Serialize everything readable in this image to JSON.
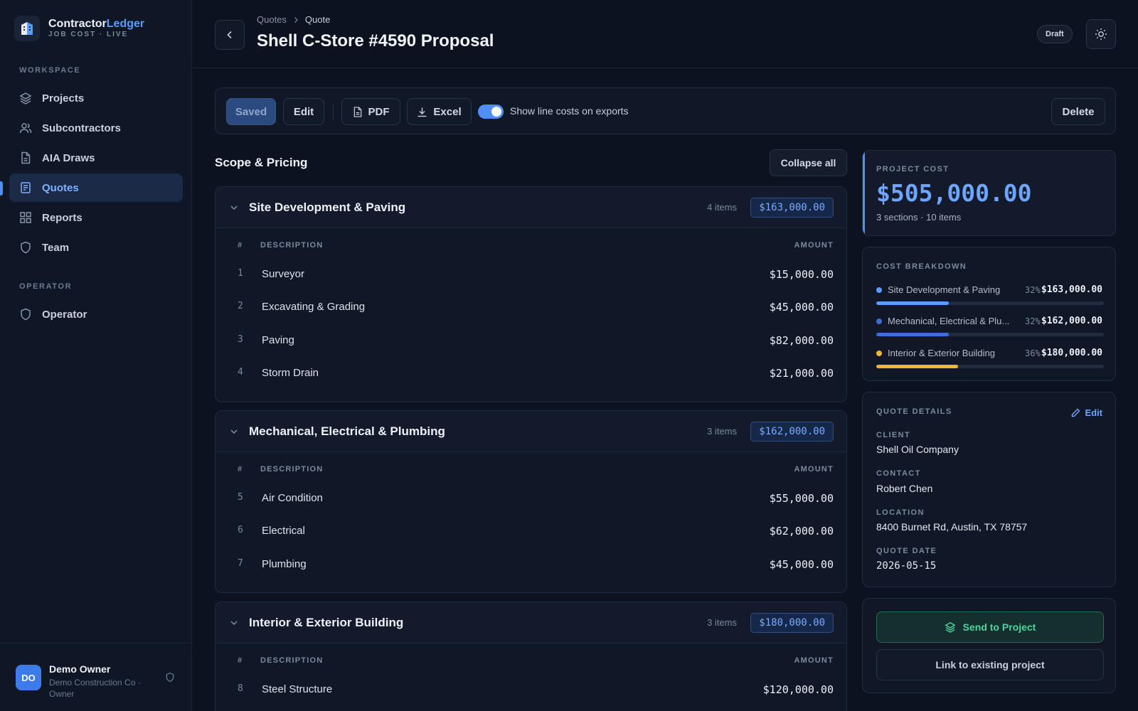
{
  "brand": {
    "name_main": "Contractor",
    "name_accent": "Ledger",
    "subtitle": "JOB COST · LIVE"
  },
  "sidebar": {
    "workspace_label": "WORKSPACE",
    "items": [
      {
        "label": "Projects",
        "icon": "layers-icon"
      },
      {
        "label": "Subcontractors",
        "icon": "users-icon"
      },
      {
        "label": "AIA Draws",
        "icon": "document-icon"
      },
      {
        "label": "Quotes",
        "icon": "receipt-icon",
        "active": true
      },
      {
        "label": "Reports",
        "icon": "grid-icon"
      },
      {
        "label": "Team",
        "icon": "shield-icon"
      }
    ],
    "operator_label": "OPERATOR",
    "operator_item": {
      "label": "Operator",
      "icon": "shield-icon"
    },
    "user": {
      "initials": "DO",
      "name": "Demo Owner",
      "org": "Demo Construction Co · Owner"
    }
  },
  "header": {
    "breadcrumb": [
      "Quotes",
      "Quote"
    ],
    "title": "Shell C-Store #4590 Proposal",
    "status": "Draft"
  },
  "toolbar": {
    "saved_label": "Saved",
    "edit_label": "Edit",
    "pdf_label": "PDF",
    "excel_label": "Excel",
    "toggle_label": "Show line costs on exports",
    "toggle_on": true,
    "delete_label": "Delete"
  },
  "scope": {
    "title": "Scope & Pricing",
    "collapse_label": "Collapse all",
    "col_num": "#",
    "col_desc": "DESCRIPTION",
    "col_amount": "AMOUNT",
    "sections": [
      {
        "name": "Site Development & Paving",
        "count": "4 items",
        "total": "$163,000.00",
        "rows": [
          {
            "num": "1",
            "desc": "Surveyor",
            "amount": "$15,000.00"
          },
          {
            "num": "2",
            "desc": "Excavating & Grading",
            "amount": "$45,000.00"
          },
          {
            "num": "3",
            "desc": "Paving",
            "amount": "$82,000.00"
          },
          {
            "num": "4",
            "desc": "Storm Drain",
            "amount": "$21,000.00"
          }
        ]
      },
      {
        "name": "Mechanical, Electrical & Plumbing",
        "count": "3 items",
        "total": "$162,000.00",
        "rows": [
          {
            "num": "5",
            "desc": "Air Condition",
            "amount": "$55,000.00"
          },
          {
            "num": "6",
            "desc": "Electrical",
            "amount": "$62,000.00"
          },
          {
            "num": "7",
            "desc": "Plumbing",
            "amount": "$45,000.00"
          }
        ]
      },
      {
        "name": "Interior & Exterior Building",
        "count": "3 items",
        "total": "$180,000.00",
        "rows": [
          {
            "num": "8",
            "desc": "Steel Structure",
            "amount": "$120,000.00"
          }
        ]
      }
    ]
  },
  "project_cost": {
    "label": "PROJECT COST",
    "value": "$505,000.00",
    "summary": "3 sections · 10 items"
  },
  "breakdown": {
    "label": "COST BREAKDOWN",
    "items": [
      {
        "name": "Site Development & Paving",
        "pct": "32%",
        "amount": "$163,000.00",
        "fraction": 0.32,
        "color": "#5b9dff"
      },
      {
        "name": "Mechanical, Electrical & Plu...",
        "pct": "32%",
        "amount": "$162,000.00",
        "fraction": 0.32,
        "color": "#3f6fd6"
      },
      {
        "name": "Interior & Exterior Building",
        "pct": "36%",
        "amount": "$180,000.00",
        "fraction": 0.36,
        "color": "#f0b43c"
      }
    ]
  },
  "details": {
    "label": "QUOTE DETAILS",
    "edit_label": "Edit",
    "client_label": "CLIENT",
    "client": "Shell Oil Company",
    "contact_label": "CONTACT",
    "contact": "Robert Chen",
    "location_label": "LOCATION",
    "location": "8400 Burnet Rd, Austin, TX 78757",
    "date_label": "QUOTE DATE",
    "date": "2026-05-15"
  },
  "actions": {
    "send_label": "Send to Project",
    "link_label": "Link to existing project"
  }
}
